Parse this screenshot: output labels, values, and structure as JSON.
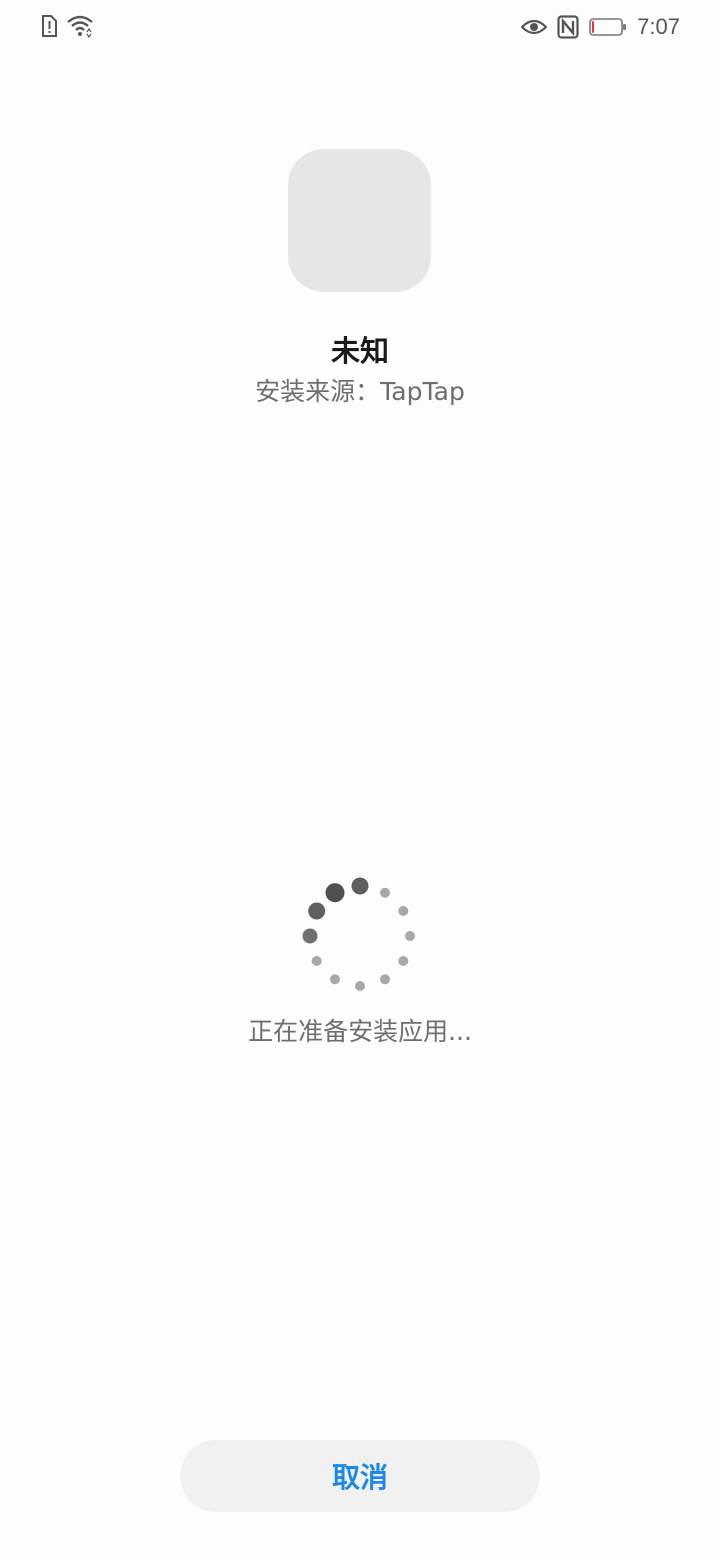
{
  "status_bar": {
    "time": "7:07",
    "left_icons": [
      "sim-alert-icon",
      "wifi-icon"
    ],
    "right_icons": [
      "eye-icon",
      "nfc-icon",
      "battery-low-icon"
    ],
    "battery_level": 0.08,
    "battery_color": "#e53935"
  },
  "app": {
    "name": "未知",
    "source": "安装来源：TapTap"
  },
  "progress": {
    "text": "正在准备安装应用..."
  },
  "actions": {
    "cancel_label": "取消",
    "accent_color": "#1e88e5"
  }
}
